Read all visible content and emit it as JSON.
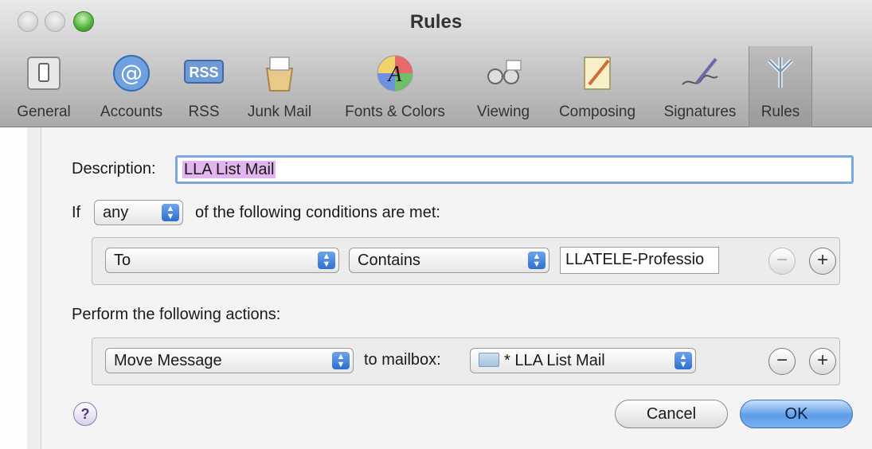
{
  "window": {
    "title": "Rules"
  },
  "toolbar": {
    "items": [
      {
        "label": "General",
        "icon": "general-switch-icon"
      },
      {
        "label": "Accounts",
        "icon": "at-sign-icon"
      },
      {
        "label": "RSS",
        "icon": "rss-icon"
      },
      {
        "label": "Junk Mail",
        "icon": "junk-mail-icon"
      },
      {
        "label": "Fonts & Colors",
        "icon": "fonts-colors-icon"
      },
      {
        "label": "Viewing",
        "icon": "viewing-glasses-icon"
      },
      {
        "label": "Composing",
        "icon": "composing-pencil-icon"
      },
      {
        "label": "Signatures",
        "icon": "signature-pen-icon"
      },
      {
        "label": "Rules",
        "icon": "rules-icon"
      }
    ],
    "selected": "Rules"
  },
  "rule": {
    "description_label": "Description:",
    "description_value": "LLA List Mail",
    "if_label": "If",
    "match_option": "any",
    "conditions_text": "of the following conditions are met:",
    "condition": {
      "field": "To",
      "operator": "Contains",
      "value": "LLATELE-Professio"
    },
    "actions_label": "Perform the following actions:",
    "action": {
      "type": "Move Message",
      "to_label": "to mailbox:",
      "mailbox": "* LLA List Mail"
    }
  },
  "buttons": {
    "help": "?",
    "cancel": "Cancel",
    "ok": "OK",
    "remove": "−",
    "add": "+"
  },
  "colors": {
    "ok_button": "#5d9de8",
    "focus_ring": "#7aa7e6",
    "selection": "#e3b5ee"
  }
}
